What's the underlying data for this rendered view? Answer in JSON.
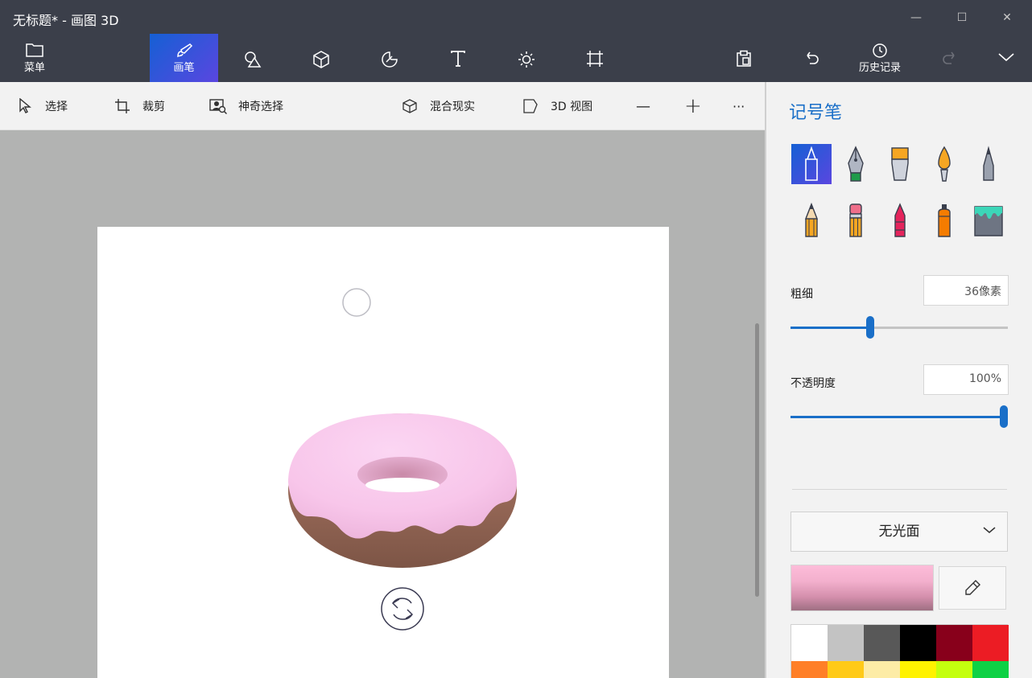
{
  "window": {
    "title": "无标题* - 画图 3D",
    "minimize": "—",
    "maximize": "☐",
    "close": "✕"
  },
  "ribbon": {
    "menu_label": "菜单",
    "brushes_label": "画笔",
    "history_label": "历史记录",
    "tools": [
      {
        "icon": "shapes-2d-icon"
      },
      {
        "icon": "shapes-3d-icon"
      },
      {
        "icon": "stickers-icon"
      },
      {
        "icon": "text-icon"
      },
      {
        "icon": "effects-icon"
      },
      {
        "icon": "canvas-icon"
      }
    ]
  },
  "subbar": {
    "select": "选择",
    "crop": "裁剪",
    "magic_select": "神奇选择",
    "mixed_reality": "混合现实",
    "view_3d": "3D 视图",
    "zoom_out": "—",
    "zoom_in": "+",
    "more": "···"
  },
  "panel": {
    "title": "记号笔",
    "brushes": [
      {
        "name": "marker",
        "selected": true
      },
      {
        "name": "calligraphy-pen"
      },
      {
        "name": "oil-brush"
      },
      {
        "name": "watercolor"
      },
      {
        "name": "pixel-pen"
      },
      {
        "name": "pencil"
      },
      {
        "name": "eraser"
      },
      {
        "name": "crayon"
      },
      {
        "name": "spray-can"
      },
      {
        "name": "fill"
      }
    ],
    "thickness_label": "粗细",
    "thickness_value": "36像素",
    "thickness_fraction": 0.36,
    "opacity_label": "不透明度",
    "opacity_value": "100%",
    "opacity_fraction": 1.0,
    "finish": "无光面",
    "current_color": "#f7b6d2",
    "palette": [
      "#ffffff",
      "#c3c3c3",
      "#585858",
      "#000000",
      "#88001b",
      "#ec1c24",
      "#ff7f27",
      "#ffca18",
      "#fdeca6",
      "#fff200",
      "#c4ff0e",
      "#0ed145"
    ]
  }
}
